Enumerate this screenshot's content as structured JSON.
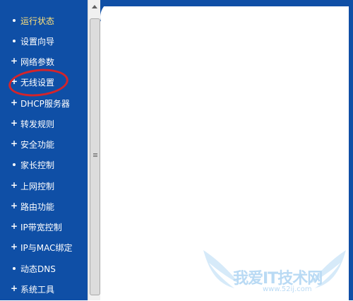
{
  "sidebar": {
    "items": [
      {
        "label": "运行状态",
        "bullet": "dot",
        "active": true
      },
      {
        "label": "设置向导",
        "bullet": "dot"
      },
      {
        "label": "网络参数",
        "bullet": "plus"
      },
      {
        "label": "无线设置",
        "bullet": "plus",
        "highlighted": true
      },
      {
        "label": "DHCP服务器",
        "bullet": "plus"
      },
      {
        "label": "转发规则",
        "bullet": "plus"
      },
      {
        "label": "安全功能",
        "bullet": "plus"
      },
      {
        "label": "家长控制",
        "bullet": "dot"
      },
      {
        "label": "上网控制",
        "bullet": "plus"
      },
      {
        "label": "路由功能",
        "bullet": "plus"
      },
      {
        "label": "IP带宽控制",
        "bullet": "plus"
      },
      {
        "label": "IP与MAC绑定",
        "bullet": "plus"
      },
      {
        "label": "动态DNS",
        "bullet": "dot"
      },
      {
        "label": "系统工具",
        "bullet": "plus"
      }
    ]
  },
  "watermark": {
    "title": "我爱IT技术网",
    "url": "www.52ij.com"
  },
  "colors": {
    "sidebar_bg": "#0f4fa6",
    "active_text": "#ffe27a",
    "highlight_circle": "#d4242b"
  }
}
